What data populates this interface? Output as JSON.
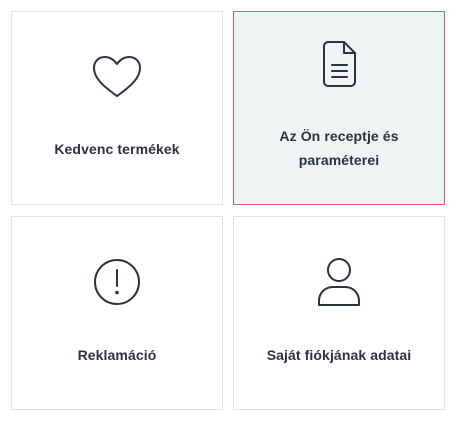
{
  "tiles": [
    {
      "id": "favorites",
      "label": "Kedvenc termékek",
      "icon": "heart-icon",
      "active": false
    },
    {
      "id": "prescription",
      "label": "Az Ön receptje és paraméterei",
      "icon": "document-icon",
      "active": true
    },
    {
      "id": "complaint",
      "label": "Reklamáció",
      "icon": "exclamation-circle-icon",
      "active": false
    },
    {
      "id": "account",
      "label": "Saját fiókjának adatai",
      "icon": "user-icon",
      "active": false
    }
  ],
  "colors": {
    "text": "#2a3441",
    "active_border": "#e0566b",
    "active_background": "#eef3f3",
    "border": "#e3e3e3"
  }
}
